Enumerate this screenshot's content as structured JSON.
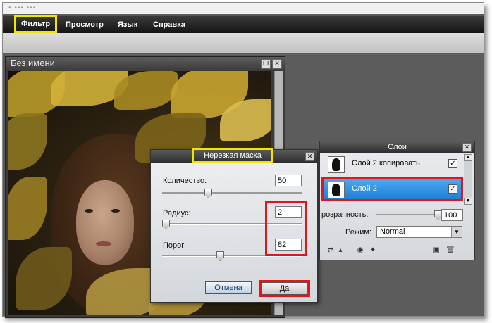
{
  "menubar": {
    "items": [
      "Фильтр",
      "Просмотр",
      "Язык",
      "Справка"
    ]
  },
  "document": {
    "title": "Без имени"
  },
  "unsharp_dialog": {
    "title": "Нерезкая маска",
    "amount_label": "Количество:",
    "amount_value": "50",
    "radius_label": "Радиус:",
    "radius_value": "2",
    "threshold_label": "Порог",
    "threshold_value": "82",
    "cancel_label": "Отмена",
    "ok_label": "Да"
  },
  "layers_panel": {
    "title": "Слои",
    "layers": [
      {
        "name": "Слой 2 копировать",
        "checked": true,
        "selected": false
      },
      {
        "name": "Слой 2",
        "checked": true,
        "selected": true
      }
    ],
    "opacity_label": "розрачность:",
    "opacity_value": "100",
    "mode_label": "Режим:",
    "mode_value": "Normal"
  },
  "colors": {
    "highlight_yellow": "#f5e300",
    "highlight_red": "#e3141c",
    "selected_layer": "#2f97e6"
  }
}
